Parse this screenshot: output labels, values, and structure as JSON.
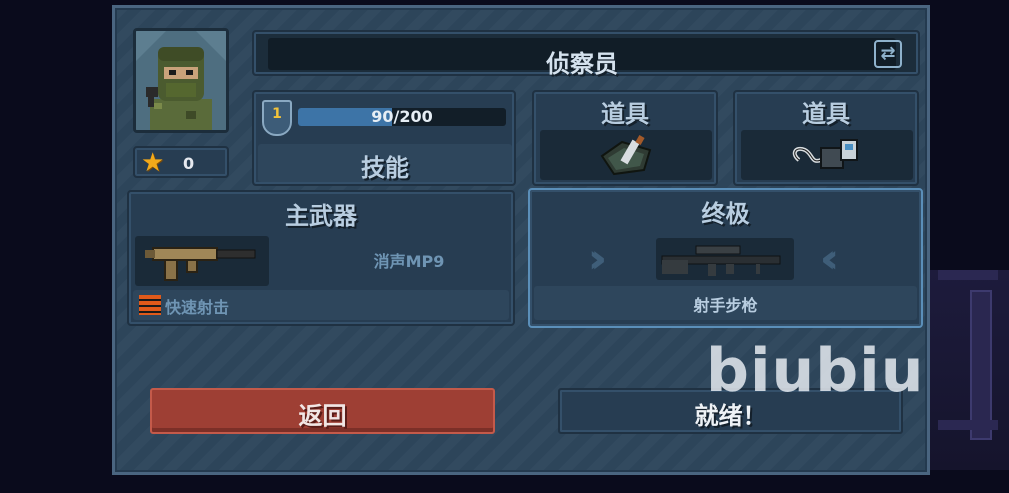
{
  "character": {
    "name": "侦察员",
    "stars": "0"
  },
  "skill": {
    "level": "1",
    "xp_text": "90/200",
    "xp_fraction": 0.45,
    "label": "技能"
  },
  "items": [
    {
      "label": "道具",
      "icon": "grenade-pack-icon"
    },
    {
      "label": "道具",
      "icon": "detonator-icon"
    }
  ],
  "primary_weapon": {
    "label": "主武器",
    "name": "消声MP9",
    "trait": "快速射击",
    "icon": "smg-icon"
  },
  "ultimate": {
    "label": "终极",
    "name": "射手步枪",
    "icon": "sniper-rifle-icon"
  },
  "buttons": {
    "back": "返回",
    "ready": "就绪！"
  },
  "watermark": "biubiu",
  "colors": {
    "back_button": "#9e3f34",
    "xp_fill": "#3d74a7",
    "star": "#f2a91a"
  }
}
